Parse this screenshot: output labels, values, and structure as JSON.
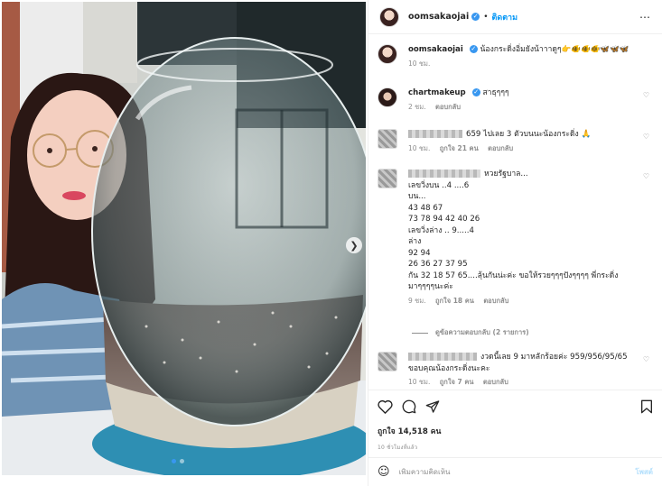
{
  "post": {
    "username": "oomsakaojai",
    "follow_label": "ติดตาม",
    "more_icon": "more-horizontal-icon",
    "caption": "น้องกระดิ่งอิ่มยังน้าาาดูๆ👉🐠🐠🐠🦋🦋🦋",
    "caption_time": "10 ชม.",
    "carousel_next_icon": "chevron-right-icon"
  },
  "comments": [
    {
      "user": "chartmakeup",
      "text": "สาธุๆๆๆ",
      "time": "2 ชม.",
      "reply": "ตอบกลับ"
    },
    {
      "user": "",
      "text": "659 ไปเลย 3 ตัวบนนะน้องกระดิ่ง 🙏",
      "time": "10 ชม.",
      "likes": "ถูกใจ 21 คน",
      "reply": "ตอบกลับ"
    },
    {
      "user": "",
      "lines": [
        "หวยรัฐบาล...",
        "เลขวิ่งบน ..4 ....6",
        "บน...",
        "43 48 67",
        "73 78 94 42 40 26",
        "เลขวิ่งล่าง .. 9.....4",
        "ล่าง",
        "92 94",
        "26 36 27 37 95",
        "กัน 32 18 57 65....ลุ้นกันน่ะค่ะ ขอให้รวยๆๆๆปังๆๆๆๆ พี่กระดิ่ง",
        "มาๆๆๆๆนะค่ะ"
      ],
      "time": "9 ชม.",
      "likes": "ถูกใจ 18 คน",
      "reply": "ตอบกลับ",
      "view_replies": "ดูข้อความตอบกลับ (2 รายการ)"
    },
    {
      "user": "",
      "lines": [
        "งวดนี้เลย 9 มาหลักร้อยค่ะ 959/956/95/65",
        "ขอบคุณน้องกระดิ่งนะคะ"
      ],
      "time": "10 ชม.",
      "likes": "ถูกใจ 7 คน",
      "reply": "ตอบกลับ"
    }
  ],
  "actions": {
    "like_icon": "heart-icon",
    "comment_icon": "comment-icon",
    "share_icon": "share-icon",
    "save_icon": "bookmark-icon",
    "likes_text": "ถูกใจ 14,518 คน",
    "posted_time": "10 ชั่วโมงที่แล้ว"
  },
  "add_comment": {
    "emoji_icon": "smiley-icon",
    "placeholder": "เพิ่มความคิดเห็น",
    "post_label": "โพสต์"
  },
  "colors": {
    "accent": "#0095f6",
    "verified": "#3897f0",
    "muted": "#8e8e8e"
  }
}
